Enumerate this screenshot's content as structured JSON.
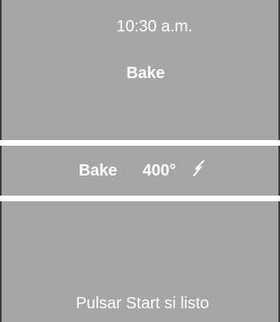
{
  "screen": {
    "clock": "10:30 a.m.",
    "mode_title": "Bake",
    "status": {
      "mode": "Bake",
      "temperature": "400°",
      "icon": "lightning-bolt-icon"
    },
    "prompt": "Pulsar Start si listo"
  },
  "colors": {
    "panel": "#a6a6a6",
    "border": "#3a3a3a",
    "text": "#ffffff"
  }
}
